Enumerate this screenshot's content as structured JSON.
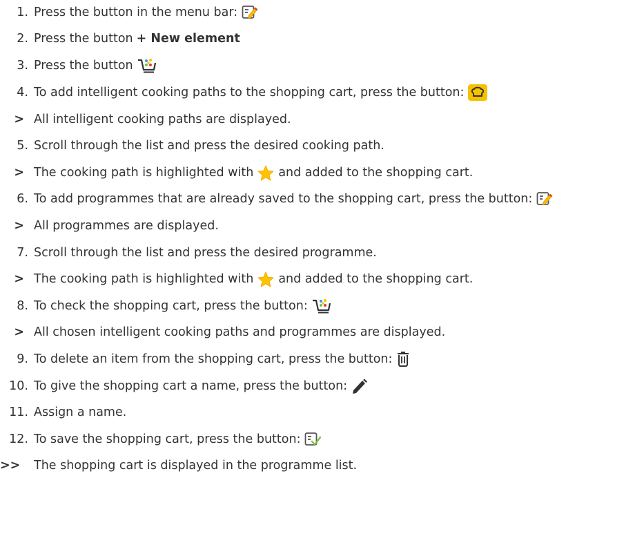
{
  "steps": [
    {
      "marker": "1.",
      "text": "Press the button in the menu bar:",
      "icon": "edit-list-icon"
    },
    {
      "marker": "2.",
      "text": "Press the button",
      "bold": "+ New element"
    },
    {
      "marker": "3.",
      "text": "Press the button",
      "icon": "shopping-cart-icon"
    },
    {
      "marker": "4.",
      "text": "To add intelligent cooking paths to the shopping cart, press the button:",
      "icon": "chef-hat-icon"
    },
    {
      "marker": ">",
      "text": "All intelligent cooking paths are displayed."
    },
    {
      "marker": "5.",
      "text": "Scroll through the list and press the desired cooking path."
    },
    {
      "marker": ">",
      "text": "The cooking path is highlighted with",
      "icon": "star-icon",
      "text_after": "and added to the shopping cart."
    },
    {
      "marker": "6.",
      "text": "To add programmes that are already saved to the shopping cart, press the button:",
      "icon": "edit-list-icon"
    },
    {
      "marker": ">",
      "text": "All programmes are displayed."
    },
    {
      "marker": "7.",
      "text": "Scroll through the list and press the desired programme."
    },
    {
      "marker": ">",
      "text": "The cooking path is highlighted with",
      "icon": "star-icon",
      "text_after": "and added to the shopping cart."
    },
    {
      "marker": "8.",
      "text": "To check the shopping cart, press the button:",
      "icon": "shopping-cart-icon"
    },
    {
      "marker": ">",
      "text": "All chosen intelligent cooking paths and programmes are displayed."
    },
    {
      "marker": "9.",
      "text": "To delete an item from the shopping cart, press the button:",
      "icon": "trash-icon"
    },
    {
      "marker": "10.",
      "text": "To give the shopping cart a name, press the button:",
      "icon": "pencil-icon"
    },
    {
      "marker": "11.",
      "text": "Assign a name."
    },
    {
      "marker": "12.",
      "text": "To save the shopping cart, press the button:",
      "icon": "save-list-icon"
    },
    {
      "marker": ">>",
      "text": "The shopping cart is displayed in the programme list."
    }
  ],
  "colors": {
    "text": "#333333",
    "accent_yellow": "#f6c200",
    "star": "#ffc400",
    "green": "#7cc242",
    "blue": "#2aa4dc",
    "red": "#e53935"
  }
}
